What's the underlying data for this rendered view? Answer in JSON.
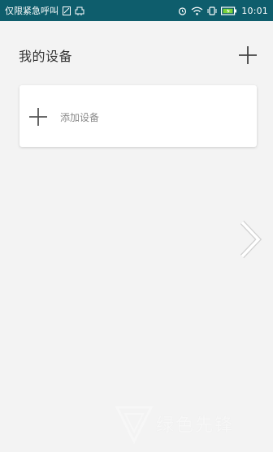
{
  "status_bar": {
    "carrier_text": "仅限紧急呼叫",
    "time": "10:01",
    "icons": [
      "sim-icon",
      "usb-icon",
      "alarm-icon",
      "wifi-icon",
      "vibrate-icon",
      "battery-icon"
    ],
    "background_color": "#0e5d6c"
  },
  "header": {
    "title": "我的设备",
    "add_icon": "plus-icon"
  },
  "device_card": {
    "label": "添加设备",
    "icon": "plus-icon"
  },
  "navigation": {
    "next_icon": "chevron-right-icon"
  },
  "watermark": {
    "text": "绿色先锋"
  },
  "colors": {
    "background": "#f3f3f3",
    "card": "#ffffff",
    "title_text": "#333333",
    "label_text": "#8a8a8a"
  }
}
